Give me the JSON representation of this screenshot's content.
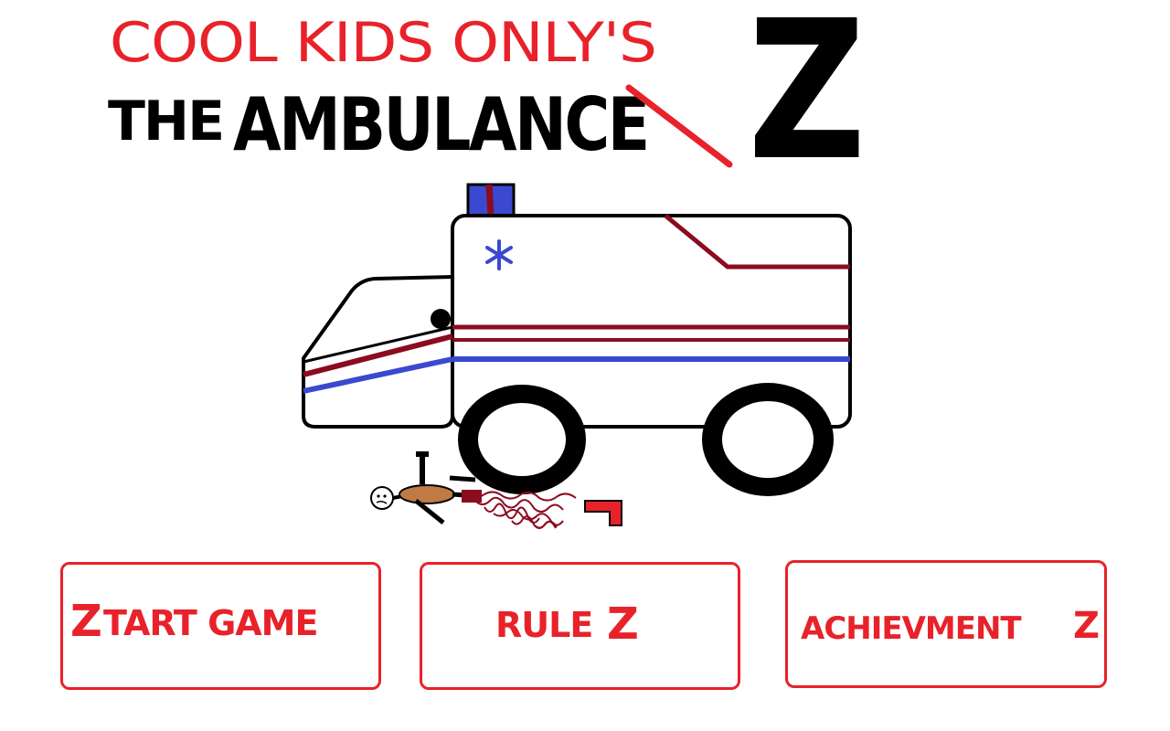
{
  "brand": {
    "text": "COOL KIDS ONLY'S",
    "color": "#e8222a"
  },
  "title": {
    "prefix": "THE",
    "main": "AMBULANCE",
    "suffix": "Z",
    "strike_color": "#e8222a"
  },
  "menu": {
    "accent": "#e8222a",
    "buttons": [
      {
        "id": "start",
        "first": "Z",
        "rest": "TART GAME"
      },
      {
        "id": "rules",
        "first": "RULE",
        "rest": "Z"
      },
      {
        "id": "achievements",
        "first": "ACHIEVMENT",
        "rest": "Z"
      }
    ]
  },
  "colors": {
    "stripe_dark": "#8b0b1f",
    "stripe_blue": "#3b48d0",
    "siren": "#3b48d0",
    "blood": "#8b0b1f",
    "skin": "#c07a46"
  }
}
